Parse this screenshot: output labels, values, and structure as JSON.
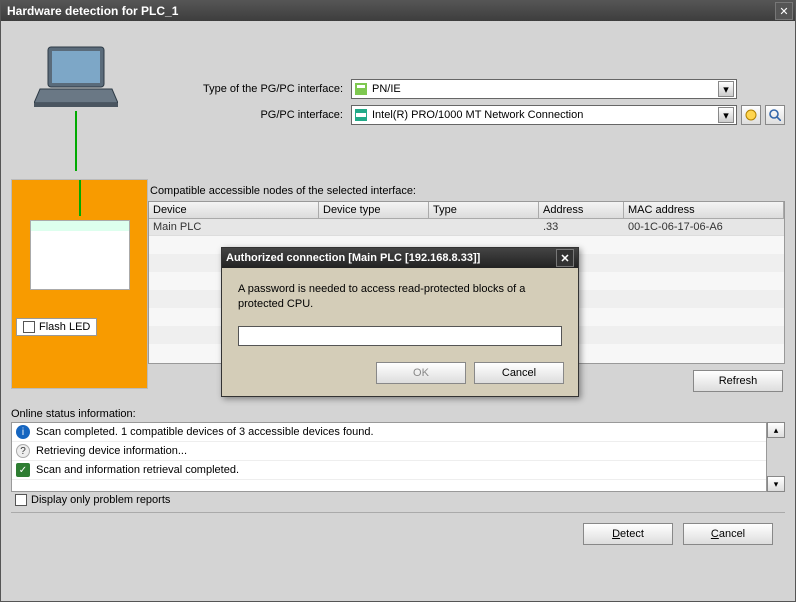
{
  "window": {
    "title": "Hardware detection for PLC_1"
  },
  "config": {
    "label_iface_type": "Type of the PG/PC interface:",
    "label_iface": "PG/PC interface:",
    "iface_type_value": "PN/IE",
    "iface_value": "Intel(R) PRO/1000 MT Network Connection"
  },
  "nodes": {
    "heading": "Compatible accessible nodes of the selected interface:",
    "cols": {
      "device": "Device",
      "devtype": "Device type",
      "type": "Type",
      "address": "Address",
      "mac": "MAC address"
    },
    "row": {
      "device": "Main PLC",
      "devtype": "",
      "type": "",
      "address": ".33",
      "mac": "00-1C-06-17-06-A6"
    }
  },
  "flash": {
    "label": "Flash LED"
  },
  "buttons": {
    "refresh": "Refresh",
    "detect": "Detect",
    "cancel": "Cancel",
    "ok": "OK"
  },
  "status": {
    "heading": "Online status information:",
    "items": [
      "Scan completed. 1 compatible devices of 3 accessible devices found.",
      "Retrieving device information...",
      "Scan and information retrieval completed."
    ],
    "display_only": "Display only problem reports"
  },
  "dialog": {
    "title": "Authorized connection [Main PLC [192.168.8.33]]",
    "msg": "A password is needed to access read-protected blocks of a protected CPU."
  }
}
